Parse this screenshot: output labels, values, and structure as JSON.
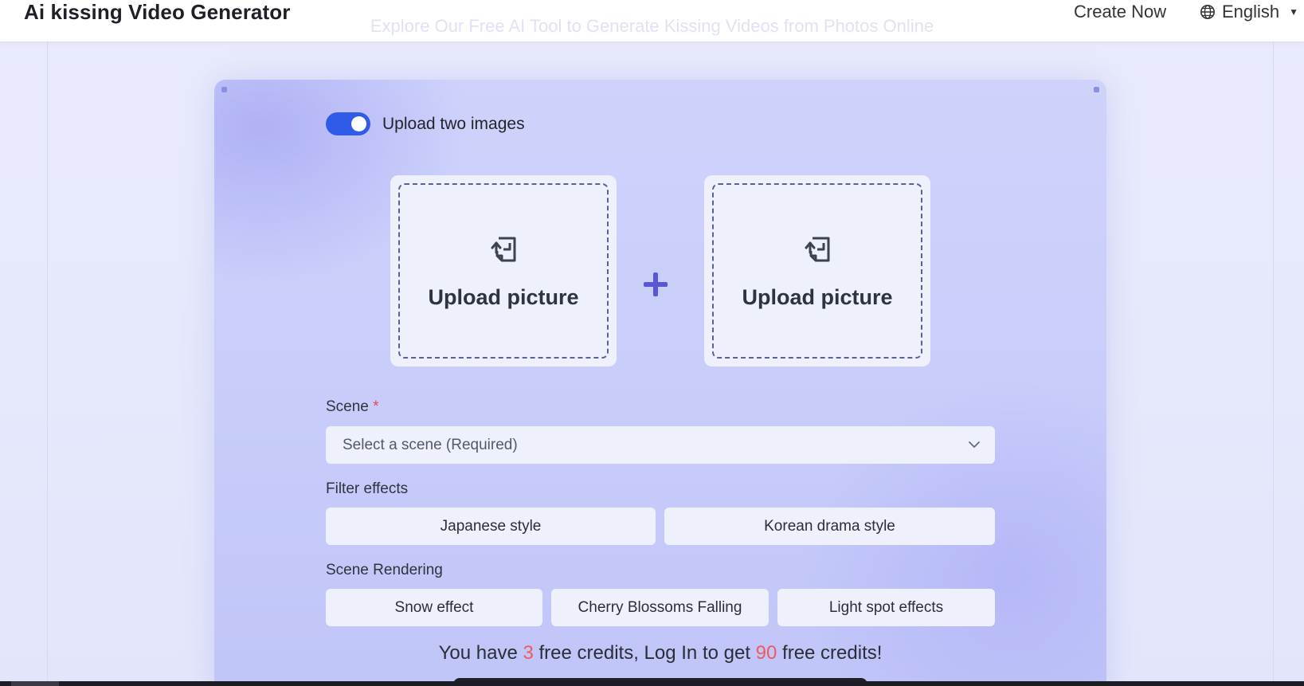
{
  "header": {
    "brand": "Ai kissing Video Generator",
    "create_now": "Create Now",
    "language": "English",
    "ghost_subtitle": "Explore Our Free AI Tool to Generate Kissing Videos from Photos Online"
  },
  "toggle": {
    "label": "Upload two images",
    "on": true
  },
  "uploads": [
    {
      "label": "Upload picture"
    },
    {
      "label": "Upload picture"
    }
  ],
  "scene": {
    "label": "Scene",
    "required_mark": "*",
    "placeholder": "Select a scene (Required)"
  },
  "filter_effects": {
    "label": "Filter effects",
    "options": [
      "Japanese style",
      "Korean drama style"
    ]
  },
  "scene_rendering": {
    "label": "Scene Rendering",
    "options": [
      "Snow effect",
      "Cherry Blossoms Falling",
      "Light spot effects"
    ]
  },
  "credits": {
    "prefix": "You have ",
    "free_now": "3",
    "middle": " free credits, Log In to get ",
    "free_login": "90",
    "suffix": " free credits!"
  },
  "colors": {
    "toggle_on": "#2f5be8",
    "accent_plus": "#5a57d6",
    "credit_number": "#ef5b5b",
    "required": "#e54b4b"
  },
  "icons": {
    "upload": "file-upload-icon",
    "plus": "plus-icon",
    "globe": "globe-icon",
    "chevron": "chevron-down-icon"
  }
}
